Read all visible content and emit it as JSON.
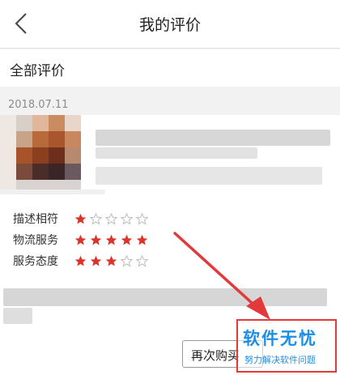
{
  "header": {
    "title": "我的评价"
  },
  "section": {
    "title": "全部评价"
  },
  "review": {
    "date": "2018.07.11",
    "ratings": [
      {
        "label": "描述相符",
        "stars": 1,
        "max": 5
      },
      {
        "label": "物流服务",
        "stars": 5,
        "max": 5
      },
      {
        "label": "服务态度",
        "stars": 3,
        "max": 5
      }
    ],
    "rebuy_label": "再次购买"
  },
  "watermark": {
    "title": "软件无忧",
    "subtitle": "努力解决软件问题"
  },
  "colors": {
    "star_filled": "#d9352b",
    "star_empty": "#bdbdbd",
    "watermark_blue": "#1b8ee6",
    "arrow_red": "#e23a3a"
  },
  "icons": {
    "back": "chevron-left-icon",
    "star": "star-icon"
  }
}
